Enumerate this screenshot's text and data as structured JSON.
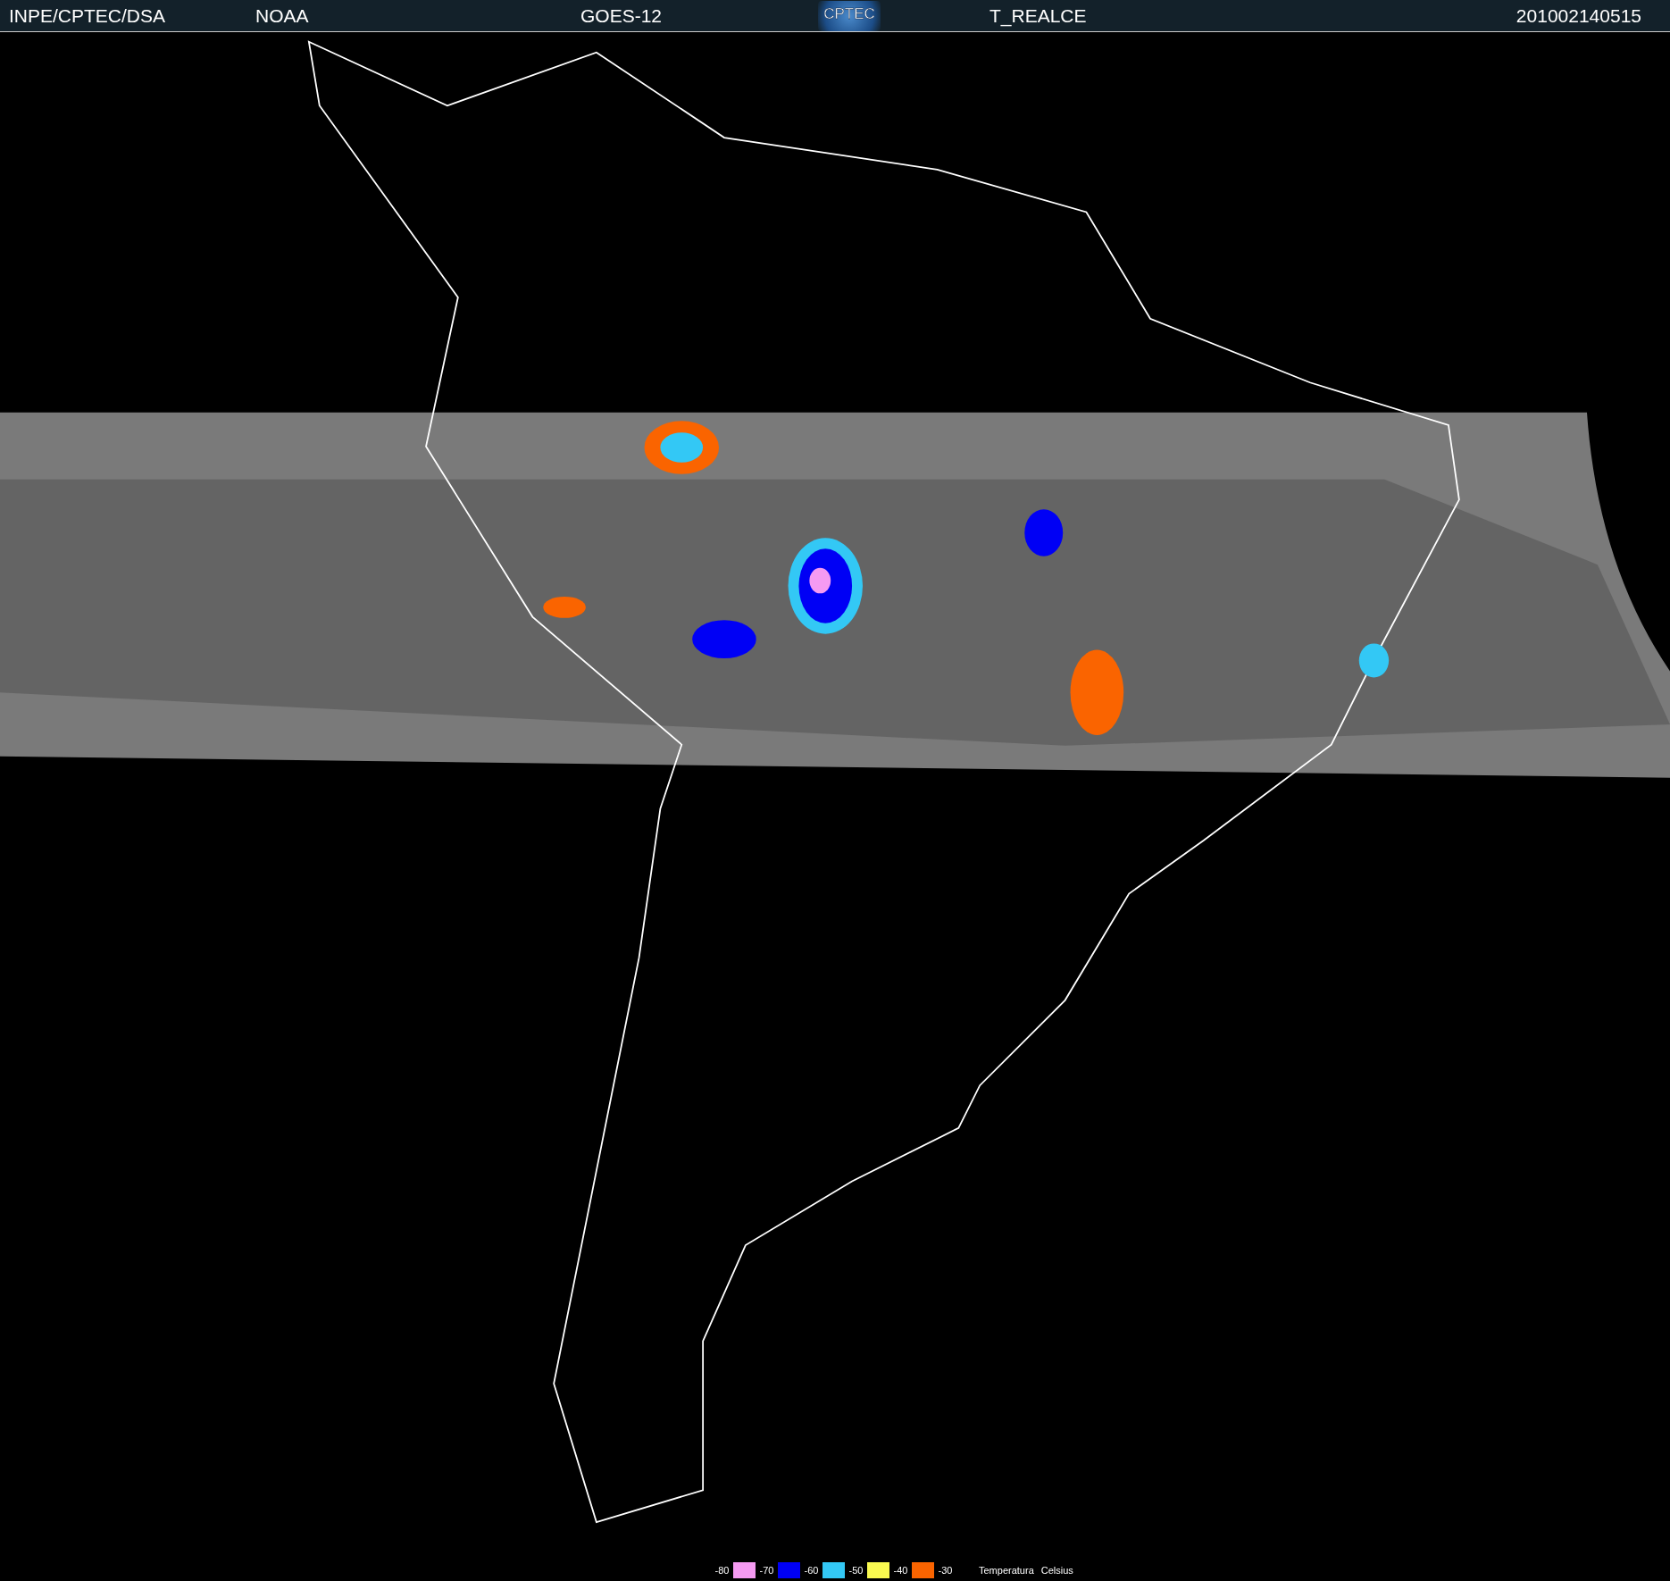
{
  "header": {
    "source": "INPE/CPTEC/DSA",
    "agency": "NOAA",
    "satellite": "GOES-12",
    "logo": "CPTEC",
    "product": "T_REALCE",
    "timestamp": "201002140515"
  },
  "legend": {
    "steps": [
      {
        "label": "-80",
        "color": "#f59af2"
      },
      {
        "label": "-70",
        "color": "#0000f5"
      },
      {
        "label": "-60",
        "color": "#33c8f5"
      },
      {
        "label": "-50",
        "color": "#fafa50"
      },
      {
        "label": "-40",
        "color": "#fa6400"
      }
    ],
    "last_label": "-30",
    "caption": "Temperatura",
    "unit": "Celsius"
  }
}
